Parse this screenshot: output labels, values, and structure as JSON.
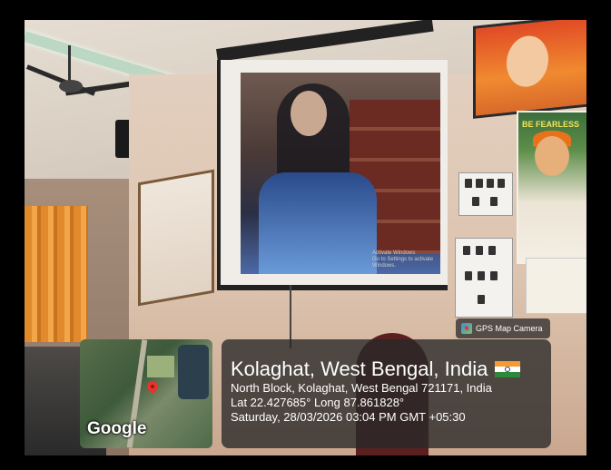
{
  "projection": {
    "activate_line1": "Activate Windows",
    "activate_line2": "Go to Settings to activate Windows."
  },
  "poster": {
    "title": "BE FEARLESS"
  },
  "overlay": {
    "badge_label": "GPS Map Camera",
    "map_logo": "Google",
    "city": "Kolaghat, West Bengal, India",
    "address": "North Block, Kolaghat, West Bengal 721171, India",
    "coords": "Lat 22.427685° Long 87.861828°",
    "datetime": "Saturday, 28/03/2026 03:04 PM GMT +05:30",
    "flag_icon": "india-flag-icon",
    "pin_icon": "map-pin-icon",
    "colors": {
      "panel_bg": "#282828",
      "pin": "#e8322c",
      "saffron": "#f39a34",
      "green": "#2c8a3a"
    }
  }
}
